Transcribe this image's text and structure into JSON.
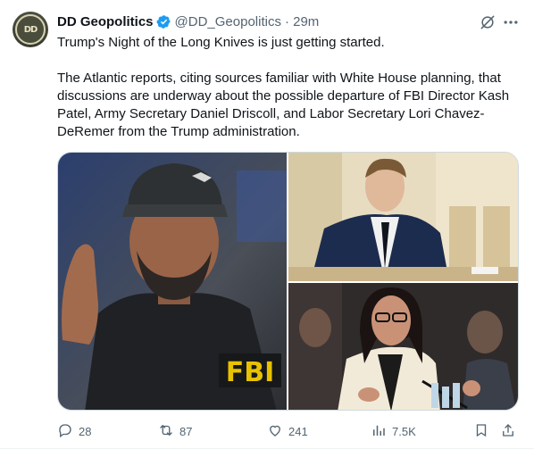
{
  "author": {
    "name": "DD Geopolitics",
    "handle": "@DD_Geopolitics",
    "time": "· 29m",
    "avatar_text": "DD"
  },
  "post": {
    "line1": "Trump's Night of the Long Knives is just getting started.",
    "line2": "The Atlantic reports, citing sources familiar with White House planning, that discussions are underway about the possible departure of FBI Director Kash Patel, Army Secretary Daniel Driscoll, and Labor Secretary Lori Chavez-DeRemer from the Trump administration."
  },
  "media": {
    "left_badge_text": "FBI"
  },
  "actions": {
    "replies": "28",
    "reposts": "87",
    "likes": "241",
    "views": "7.5K"
  },
  "colors": {
    "verified": "#1d9bf0",
    "secondary_text": "#536471"
  },
  "icons": [
    "verified-badge-icon",
    "grok-icon",
    "more-icon",
    "reply-icon",
    "repost-icon",
    "like-icon",
    "views-icon",
    "bookmark-icon",
    "share-icon"
  ]
}
